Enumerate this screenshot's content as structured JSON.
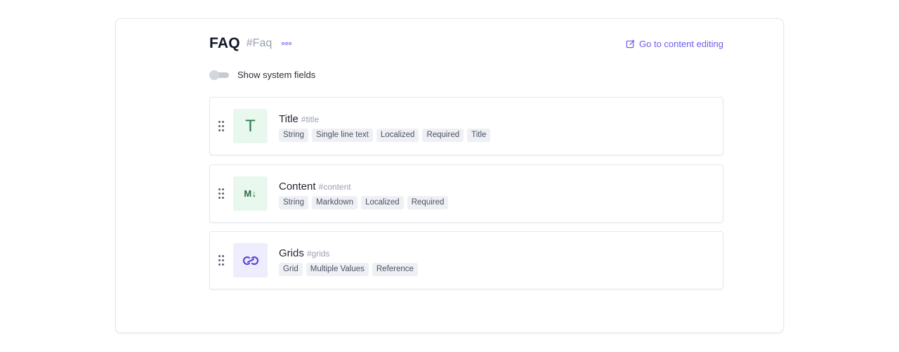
{
  "model": {
    "name": "FAQ",
    "api_id": "#Faq",
    "more_icon": "more-dots-icon"
  },
  "actions": {
    "go_to_content_label": "Go to content editing",
    "go_to_content_icon": "edit-icon"
  },
  "system_fields_toggle": {
    "label": "Show system fields",
    "checked": false
  },
  "fields": [
    {
      "name": "Title",
      "api_id": "#title",
      "icon": "text-type-icon",
      "tags": [
        "String",
        "Single line text",
        "Localized",
        "Required",
        "Title"
      ]
    },
    {
      "name": "Content",
      "api_id": "#content",
      "icon": "markdown-icon",
      "tags": [
        "String",
        "Markdown",
        "Localized",
        "Required"
      ]
    },
    {
      "name": "Grids",
      "api_id": "#grids",
      "icon": "reference-link-icon",
      "tags": [
        "Grid",
        "Multiple Values",
        "Reference"
      ]
    }
  ],
  "colors": {
    "accent": "#6c5ce7",
    "string_icon_bg": "#e9f8ee",
    "reference_icon_bg": "#eeedfd",
    "tag_bg": "#eef0f4"
  }
}
